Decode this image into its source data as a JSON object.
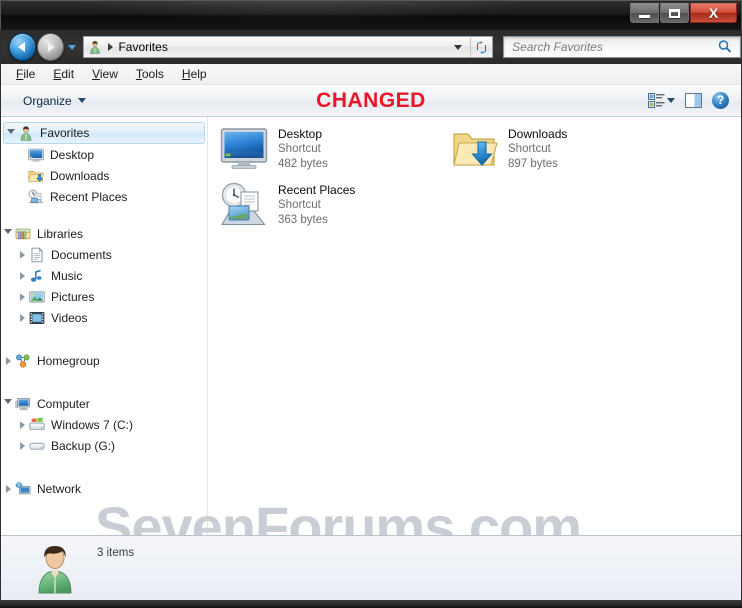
{
  "window": {
    "title": "Favorites",
    "controls": {
      "minimize_label": "Minimize",
      "maximize_label": "Maximize",
      "close_label": "X"
    }
  },
  "navigation": {
    "back_label": "Back",
    "forward_label": "Forward",
    "recent_pages_label": "Recent pages",
    "refresh_label": "↻"
  },
  "address": {
    "icon": "user-icon",
    "path_label": "Favorites",
    "dropdown_label": "Previous locations"
  },
  "search": {
    "placeholder": "Search Favorites",
    "value": "",
    "icon": "search-icon"
  },
  "menubar": {
    "items": [
      {
        "accel": "F",
        "rest": "ile"
      },
      {
        "accel": "E",
        "rest": "dit"
      },
      {
        "accel": "V",
        "rest": "iew"
      },
      {
        "accel": "T",
        "rest": "ools"
      },
      {
        "accel": "H",
        "rest": "elp"
      }
    ]
  },
  "toolbar": {
    "organize_label": "Organize",
    "banner_text": "CHANGED",
    "banner_color": "#e8182a",
    "views_label": "Change your view",
    "preview_pane_label": "Show the preview pane",
    "help_label": "?"
  },
  "sidebar": {
    "groups": [
      {
        "name": "favorites-group",
        "header": {
          "label": "Favorites",
          "icon": "favorites-star-icon",
          "expanded": true,
          "selected": true
        },
        "items": [
          {
            "label": "Desktop",
            "icon": "desktop-monitor-icon"
          },
          {
            "label": "Downloads",
            "icon": "downloads-folder-icon"
          },
          {
            "label": "Recent Places",
            "icon": "recent-places-icon"
          }
        ]
      },
      {
        "name": "libraries-group",
        "header": {
          "label": "Libraries",
          "icon": "libraries-icon",
          "expanded": true,
          "selected": false
        },
        "items": [
          {
            "label": "Documents",
            "icon": "documents-icon",
            "collapsed": true
          },
          {
            "label": "Music",
            "icon": "music-note-icon",
            "collapsed": true
          },
          {
            "label": "Pictures",
            "icon": "pictures-icon",
            "collapsed": true
          },
          {
            "label": "Videos",
            "icon": "videos-film-icon",
            "collapsed": true
          }
        ]
      },
      {
        "name": "homegroup-group",
        "header": {
          "label": "Homegroup",
          "icon": "homegroup-icon",
          "expanded": false,
          "selected": false
        },
        "items": []
      },
      {
        "name": "computer-group",
        "header": {
          "label": "Computer",
          "icon": "computer-icon",
          "expanded": true,
          "selected": false
        },
        "items": [
          {
            "label": "Windows 7 (C:)",
            "icon": "system-drive-icon",
            "collapsed": true
          },
          {
            "label": "Backup (G:)",
            "icon": "drive-icon",
            "collapsed": true
          }
        ]
      },
      {
        "name": "network-group",
        "header": {
          "label": "Network",
          "icon": "network-icon",
          "expanded": false,
          "selected": false
        },
        "items": []
      }
    ]
  },
  "content": {
    "items": [
      {
        "name": "Desktop",
        "type": "Shortcut",
        "size": "482 bytes",
        "icon": "desktop-monitor-icon"
      },
      {
        "name": "Downloads",
        "type": "Shortcut",
        "size": "897 bytes",
        "icon": "downloads-folder-icon"
      },
      {
        "name": "Recent Places",
        "type": "Shortcut",
        "size": "363 bytes",
        "icon": "recent-places-icon"
      }
    ]
  },
  "statusbar": {
    "item_count_label": "3 items",
    "avatar_icon": "user-account-avatar"
  },
  "watermark": {
    "text": "SevenForums.com",
    "color": "#c9ced5"
  }
}
